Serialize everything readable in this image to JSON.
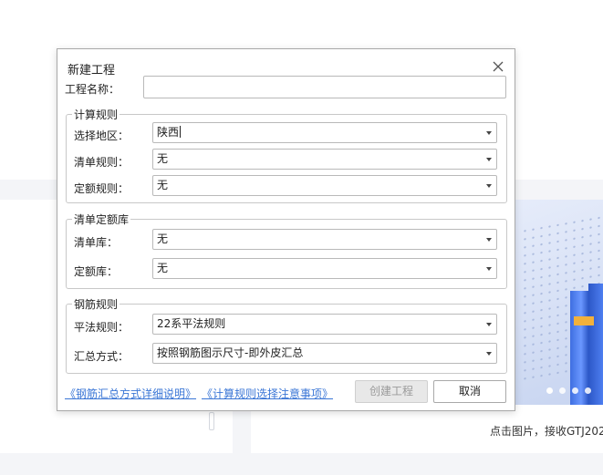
{
  "background": {
    "caption": "点击图片，接收GTJ202",
    "carousel_dots": 4
  },
  "dialog": {
    "title": "新建工程",
    "project_name": {
      "label": "工程名称：",
      "value": ""
    },
    "calc_rules": {
      "legend": "计算规则",
      "region": {
        "label": "选择地区：",
        "value": "陕西"
      },
      "bill_rule": {
        "label": "清单规则：",
        "value": "无"
      },
      "quota_rule": {
        "label": "定额规则：",
        "value": "无"
      }
    },
    "library": {
      "legend": "清单定额库",
      "bill_lib": {
        "label": "清单库：",
        "value": "无"
      },
      "quota_lib": {
        "label": "定额库：",
        "value": "无"
      }
    },
    "rebar": {
      "legend": "钢筋规则",
      "flat_rule": {
        "label": "平法规则：",
        "value": "22系平法规则"
      },
      "summary": {
        "label": "汇总方式：",
        "value": "按照钢筋图示尺寸-即外皮汇总"
      }
    },
    "links": {
      "rebar_summary": "《钢筋汇总方式详细说明》",
      "calc_notes": "《计算规则选择注意事项》"
    },
    "buttons": {
      "create": "创建工程",
      "cancel": "取消"
    }
  }
}
